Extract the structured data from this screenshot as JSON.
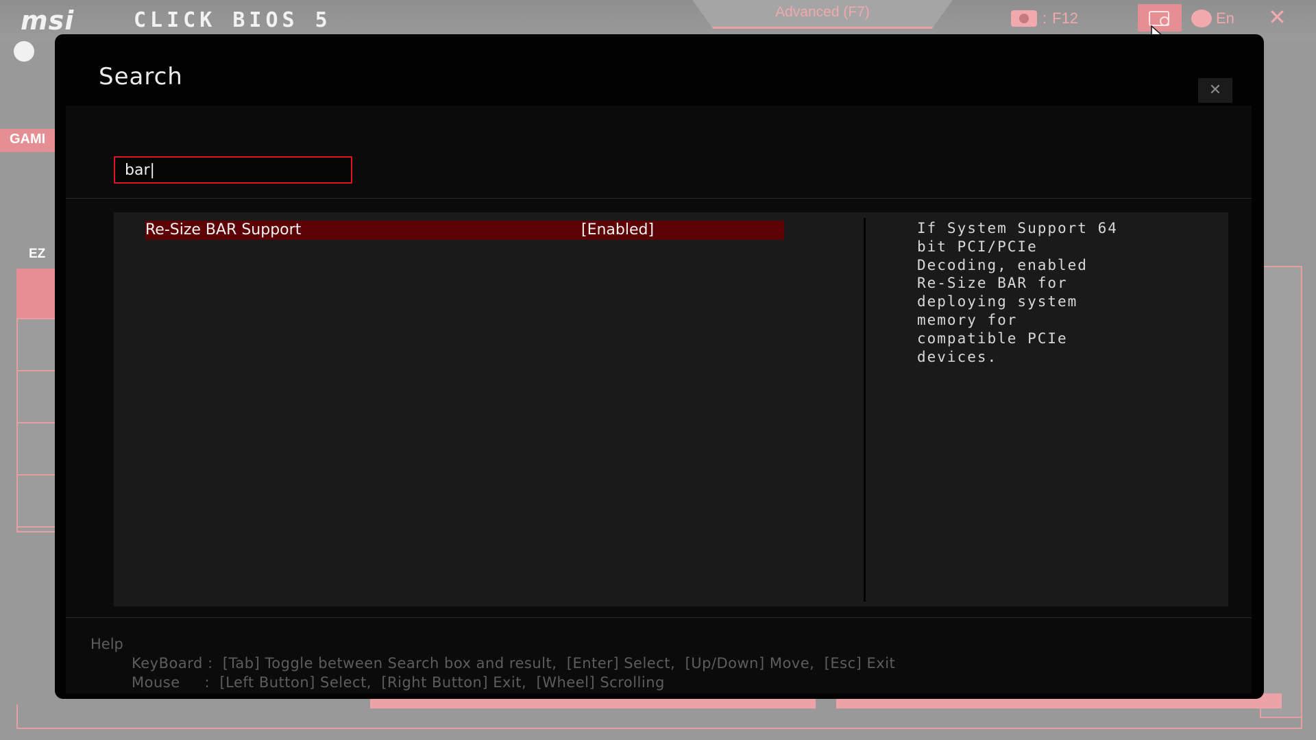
{
  "topbar": {
    "brand": "msi",
    "product": "CLICK BIOS 5",
    "mode_tab": "Advanced (F7)",
    "screenshot_key": "F12",
    "language": "En",
    "close_glyph": "✕"
  },
  "background": {
    "game_tab_label": "GAMI",
    "ez_label": "EZ"
  },
  "modal": {
    "title": "Search",
    "close_glyph": "✕",
    "search": {
      "value": "bar|",
      "placeholder": ""
    },
    "results": [
      {
        "name": "Re-Size BAR Support",
        "value": "[Enabled]"
      }
    ],
    "description": "If System Support 64\nbit PCI/PCIe\nDecoding, enabled\nRe-Size BAR for\ndeploying system\nmemory for\ncompatible PCIe\ndevices.",
    "help": {
      "heading": "Help",
      "keyboard": "KeyBoard :  [Tab] Toggle between Search box and result,  [Enter] Select,  [Up/Down] Move,  [Esc] Exit",
      "mouse": "Mouse     :  [Left Button] Select,  [Right Button] Exit,  [Wheel] Scrolling"
    }
  },
  "colors": {
    "accent_red": "#e0141f",
    "selected_row": "#5d0306",
    "pink_dim": "#f1a9ad"
  },
  "icons": [
    "clock-icon",
    "camera-icon",
    "search-icon",
    "globe-icon",
    "close-icon",
    "cursor-icon"
  ]
}
